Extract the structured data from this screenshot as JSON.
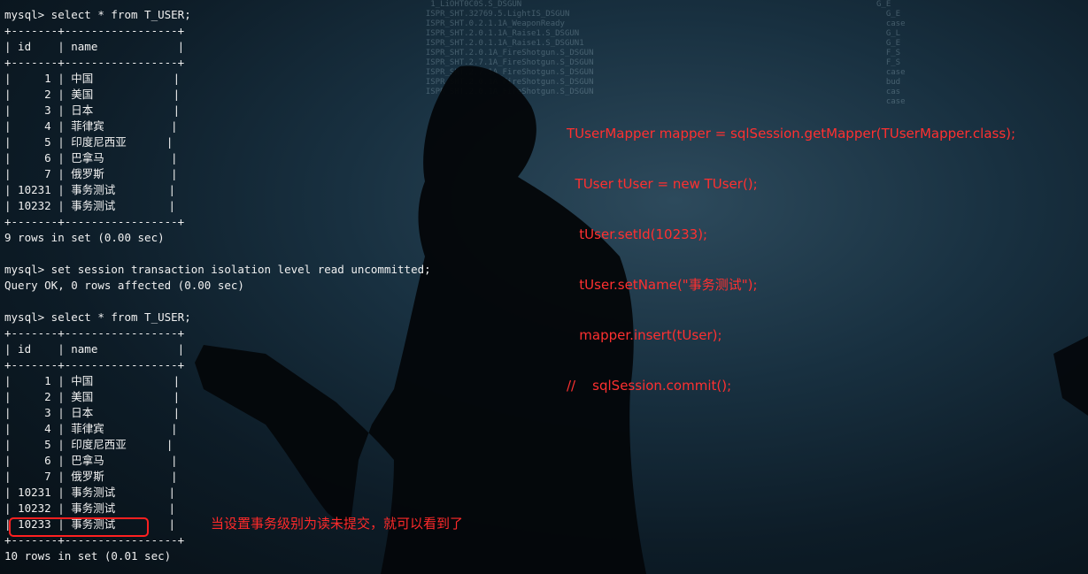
{
  "terminal": {
    "lines": [
      "mysql> select * from T_USER;",
      "+-------+-----------------+",
      "| id    | name            |",
      "+-------+-----------------+",
      "|     1 | 中国            |",
      "|     2 | 美国            |",
      "|     3 | 日本            |",
      "|     4 | 菲律宾          |",
      "|     5 | 印度尼西亚      |",
      "|     6 | 巴拿马          |",
      "|     7 | 俄罗斯          |",
      "| 10231 | 事务测试        |",
      "| 10232 | 事务测试        |",
      "+-------+-----------------+",
      "9 rows in set (0.00 sec)",
      "",
      "mysql> set session transaction isolation level read uncommitted;",
      "Query OK, 0 rows affected (0.00 sec)",
      "",
      "mysql> select * from T_USER;",
      "+-------+-----------------+",
      "| id    | name            |",
      "+-------+-----------------+",
      "|     1 | 中国            |",
      "|     2 | 美国            |",
      "|     3 | 日本            |",
      "|     4 | 菲律宾          |",
      "|     5 | 印度尼西亚      |",
      "|     6 | 巴拿马          |",
      "|     7 | 俄罗斯          |",
      "| 10231 | 事务测试        |",
      "| 10232 | 事务测试        |",
      "| 10233 | 事务测试        |",
      "+-------+-----------------+",
      "10 rows in set (0.01 sec)"
    ]
  },
  "code_overlay": {
    "lines": [
      "TUserMapper mapper = sqlSession.getMapper(TUserMapper.class);",
      "  TUser tUser = new TUser();",
      "   tUser.setId(10233);",
      "   tUser.setName(\"事务测试\");",
      "   mapper.insert(tUser);",
      "//    sqlSession.commit();"
    ]
  },
  "annotation": {
    "text": "当设置事务级别为读未提交，就可以看到了"
  },
  "colors": {
    "terminal_text": "#f0f0f0",
    "annotation_red": "#ff2a2a",
    "background": "#0a1620"
  }
}
